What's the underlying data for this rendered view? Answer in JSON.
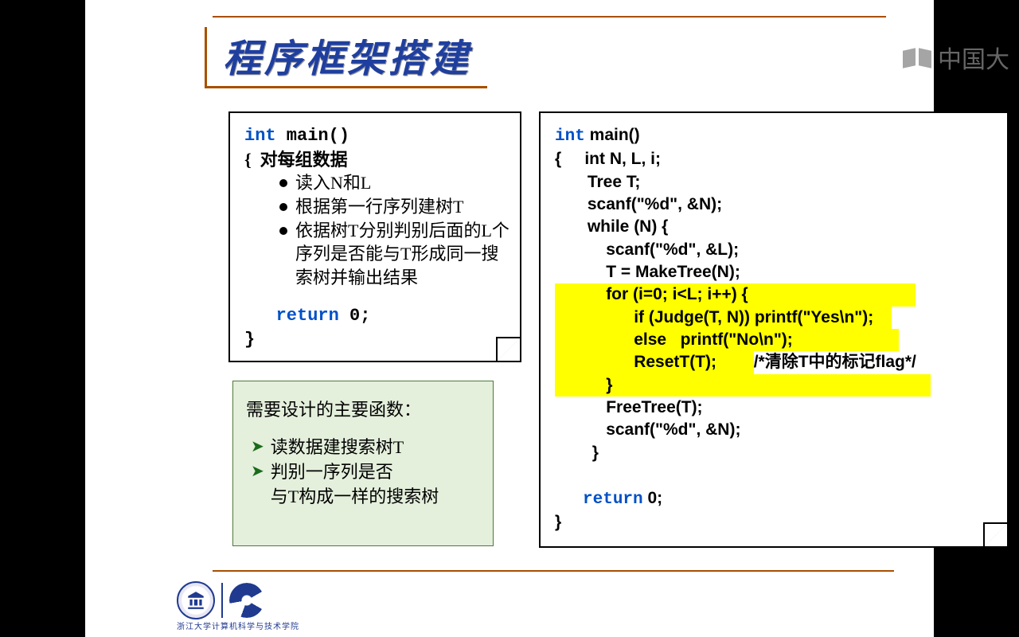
{
  "title": "程序框架搭建",
  "watermark": "中国大",
  "left_code": {
    "l1_kw": "int",
    "l1_rest": " main()",
    "l2": "{  对每组数据",
    "bullets": [
      "读入N和L",
      "根据第一行序列建树T",
      "依据树T分别判别后面的L个序列是否能与T形成同一搜索树并输出结果"
    ],
    "ret_kw": "return",
    "ret_rest": " 0;",
    "end": "}"
  },
  "green": {
    "header": "需要设计的主要函数：",
    "items": [
      "读数据建搜索树T",
      "判别一序列是否\n与T构成一样的搜索树"
    ]
  },
  "right_code": {
    "l1_kw": "int",
    "l1_rest": " main()",
    "l2": "{     int N, L, i;",
    "l3": "       Tree T;",
    "blank1": "",
    "l4": "       scanf(\"%d\", &N);",
    "l5": "       while (N) {",
    "l6": "           scanf(\"%d\", &L);",
    "l7": "           T = MakeTree(N);",
    "h1": "           for (i=0; i<L; i++) {",
    "h2": "                 if (Judge(T, N)) printf(\"Yes\\n\");",
    "h3": "                 else   printf(\"No\\n\");",
    "h4a": "                 ResetT(T);        ",
    "h4c": "/*清除T中的标记flag*/",
    "h5": "           }",
    "l8": "           FreeTree(T);",
    "l9": "           scanf(\"%d\", &N);",
    "l10": "        }",
    "blank2": "",
    "ret_kw": "return",
    "ret_pre": "      ",
    "ret_rest": " 0;",
    "end": "}"
  },
  "footer": "浙江大学计算机科学与技术学院"
}
